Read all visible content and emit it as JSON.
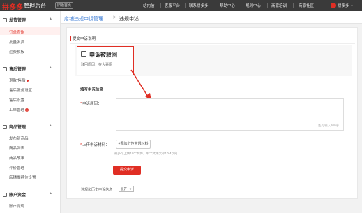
{
  "header": {
    "logo": "拼多多",
    "subtitle": "管理后台",
    "version": "旧版首页",
    "nav": [
      "站内信",
      "客服平台",
      "联系拼多多",
      "帮助中心",
      "规则中心",
      "商家培训",
      "商家社区"
    ],
    "user": "拼多多"
  },
  "sidebar": {
    "sections": [
      {
        "title": "发货管理",
        "icon": "box-icon",
        "items": [
          "订单查询",
          "批量发货",
          "运费模板"
        ]
      },
      {
        "title": "售后管理",
        "icon": "service-icon",
        "items": [
          "退款/售后",
          "售后服务设置",
          "售后设置",
          "工单管理"
        ]
      },
      {
        "title": "商品管理",
        "icon": "goods-icon",
        "items": [
          "发布新商品",
          "商品列表",
          "商品故事",
          "评价管理",
          "店铺推荐位设置"
        ]
      },
      {
        "title": "账户资金",
        "icon": "wallet-icon",
        "items": [
          "账户提现"
        ]
      }
    ],
    "badge_count": "9"
  },
  "breadcrumb": {
    "parent": "店铺违规申诉管理",
    "sep": ">",
    "current": "违规申述"
  },
  "panel": {
    "title": "提交申诉说明",
    "notice_title": "申诉被驳回",
    "notice_reason": "驳回原因：在大哥图",
    "form_title": "填写申诉信息",
    "reason_label": "申诉原因：",
    "reason_counter": "还可输入300字",
    "upload_label": "上传申诉材料：",
    "upload_button": "+添加上传申诉材料",
    "upload_hint": "最多可上传10个文件，单个文件大小10M以内",
    "submit_button": "提交申诉",
    "history_label": "违规和历史申诉信息",
    "history_select": "展开"
  },
  "colors": {
    "accent": "#e02e24",
    "topbar": "#3a3a3a"
  }
}
